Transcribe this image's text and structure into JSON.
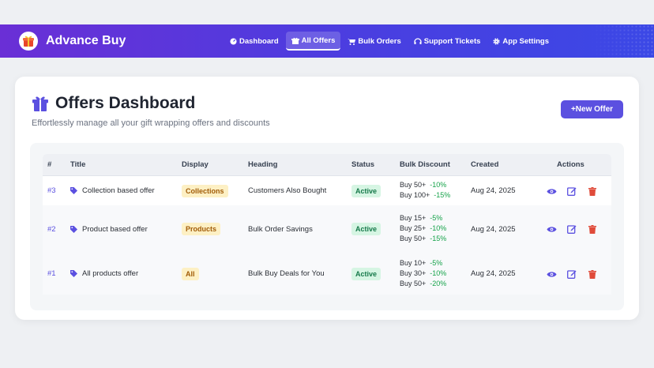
{
  "brand": {
    "name": "Advance Buy",
    "logo_icon": "gift-box-icon"
  },
  "nav": {
    "items": [
      {
        "label": "Dashboard",
        "icon": "dashboard-icon",
        "active": false
      },
      {
        "label": "All Offers",
        "icon": "gift-icon",
        "active": true
      },
      {
        "label": "Bulk Orders",
        "icon": "cart-icon",
        "active": false
      },
      {
        "label": "Support Tickets",
        "icon": "headset-icon",
        "active": false
      },
      {
        "label": "App Settings",
        "icon": "gear-icon",
        "active": false
      }
    ]
  },
  "page": {
    "title": "Offers Dashboard",
    "subtitle": "Effortlessly manage all your gift wrapping offers and discounts",
    "new_offer_label": "+New Offer"
  },
  "table": {
    "headers": [
      "#",
      "Title",
      "Display",
      "Heading",
      "Status",
      "Bulk Discount",
      "Created",
      "Actions"
    ],
    "rows": [
      {
        "id": "#3",
        "title": "Collection based offer",
        "display": "Collections",
        "heading": "Customers Also Bought",
        "status": "Active",
        "tiers": [
          {
            "label": "Buy 50+",
            "pct": "-10%"
          },
          {
            "label": "Buy 100+",
            "pct": "-15%"
          }
        ],
        "created": "Aug 24, 2025"
      },
      {
        "id": "#2",
        "title": "Product based offer",
        "display": "Products",
        "heading": "Bulk Order Savings",
        "status": "Active",
        "tiers": [
          {
            "label": "Buy 15+",
            "pct": "-5%"
          },
          {
            "label": "Buy 25+",
            "pct": "-10%"
          },
          {
            "label": "Buy 50+",
            "pct": "-15%"
          }
        ],
        "created": "Aug 24, 2025"
      },
      {
        "id": "#1",
        "title": "All products offer",
        "display": "All",
        "heading": "Bulk Buy Deals for You",
        "status": "Active",
        "tiers": [
          {
            "label": "Buy 10+",
            "pct": "-5%"
          },
          {
            "label": "Buy 30+",
            "pct": "-10%"
          },
          {
            "label": "Buy 50+",
            "pct": "-20%"
          }
        ],
        "created": "Aug 24, 2025"
      }
    ]
  },
  "colors": {
    "accent": "#5b50e0",
    "delete": "#e04b3a",
    "discount": "#16a34a",
    "nav_start": "#6a2fd6",
    "nav_end": "#3b48e6"
  }
}
